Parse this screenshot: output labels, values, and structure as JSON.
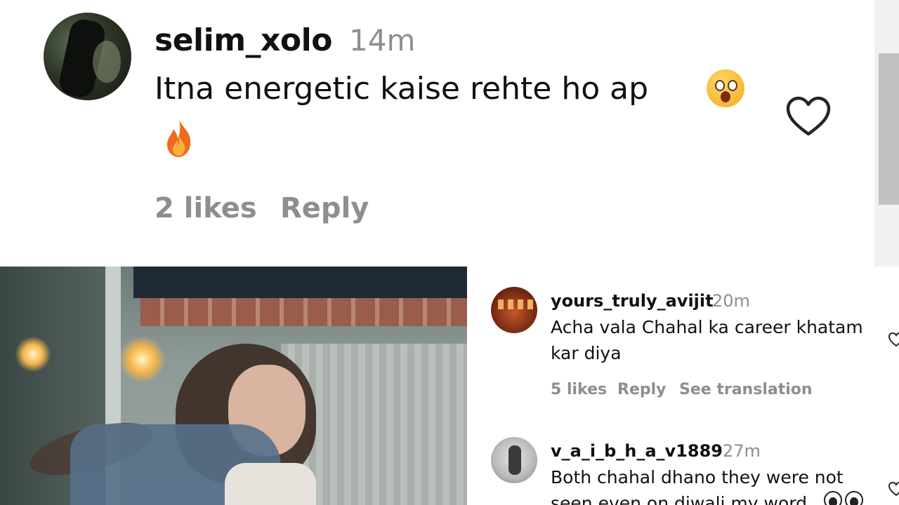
{
  "top_comment": {
    "username": "selim_xolo",
    "time": "14m",
    "text": "Itna energetic kaise rehte ho ap",
    "likes": "2 likes",
    "reply": "Reply"
  },
  "comments": [
    {
      "username": "yours_truly_avijit",
      "time": "20m",
      "text_line1": "Acha vala Chahal ka career khatam",
      "text_line2": "kar diya",
      "likes": "5 likes",
      "reply": "Reply",
      "translation": "See translation"
    },
    {
      "username": "v_a_i_b_h_a_v1889",
      "time": "27m",
      "text_line1": "Both chahal dhano they were not",
      "text_line2": "seen even on diwali my word"
    }
  ],
  "icons": {
    "like": "heart-outline-icon",
    "emoji_shocked": "astonished-face-emoji",
    "emoji_fire": "fire-emoji",
    "emoji_eyes": "eyes-emoji"
  },
  "colors": {
    "text": "#111111",
    "muted": "#8e8e8e",
    "scrollbar_thumb": "#c1c1c1"
  }
}
